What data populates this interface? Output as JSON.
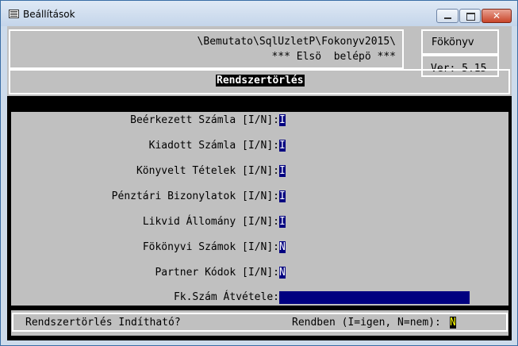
{
  "window": {
    "title": "Beállítások"
  },
  "header": {
    "path": "\\Bemutato\\SqlUzletP\\Fokonyv2015\\",
    "user": "*** Elsö  belépö ***",
    "module": "Fökönyv",
    "version": "Ver: 5.15",
    "screen_title": "Rendszertörlés"
  },
  "form": {
    "fields": [
      {
        "label": "Beérkezett Számla [I/N]:",
        "value": "I"
      },
      {
        "label": "Kiadott Számla [I/N]:",
        "value": "I"
      },
      {
        "label": "Könyvelt Tételek [I/N]:",
        "value": "I"
      },
      {
        "label": "Pénztári Bizonylatok [I/N]:",
        "value": "I"
      },
      {
        "label": "Likvid Állomány [I/N]:",
        "value": "I"
      },
      {
        "label": "Fökönyvi Számok [I/N]:",
        "value": "N"
      },
      {
        "label": "Partner Kódok [I/N]:",
        "value": "N"
      }
    ],
    "transfer_label": "Fk.Szám Átvétele:",
    "transfer_value": ""
  },
  "footer": {
    "question": "Rendszertörlés Indítható?",
    "confirm_label": "Rendben (I=igen, N=nem):",
    "confirm_value": "N"
  },
  "colors": {
    "field_bg": "#000080",
    "cursor_bg": "#ffff00",
    "panel_bg": "#c0c0c0"
  }
}
